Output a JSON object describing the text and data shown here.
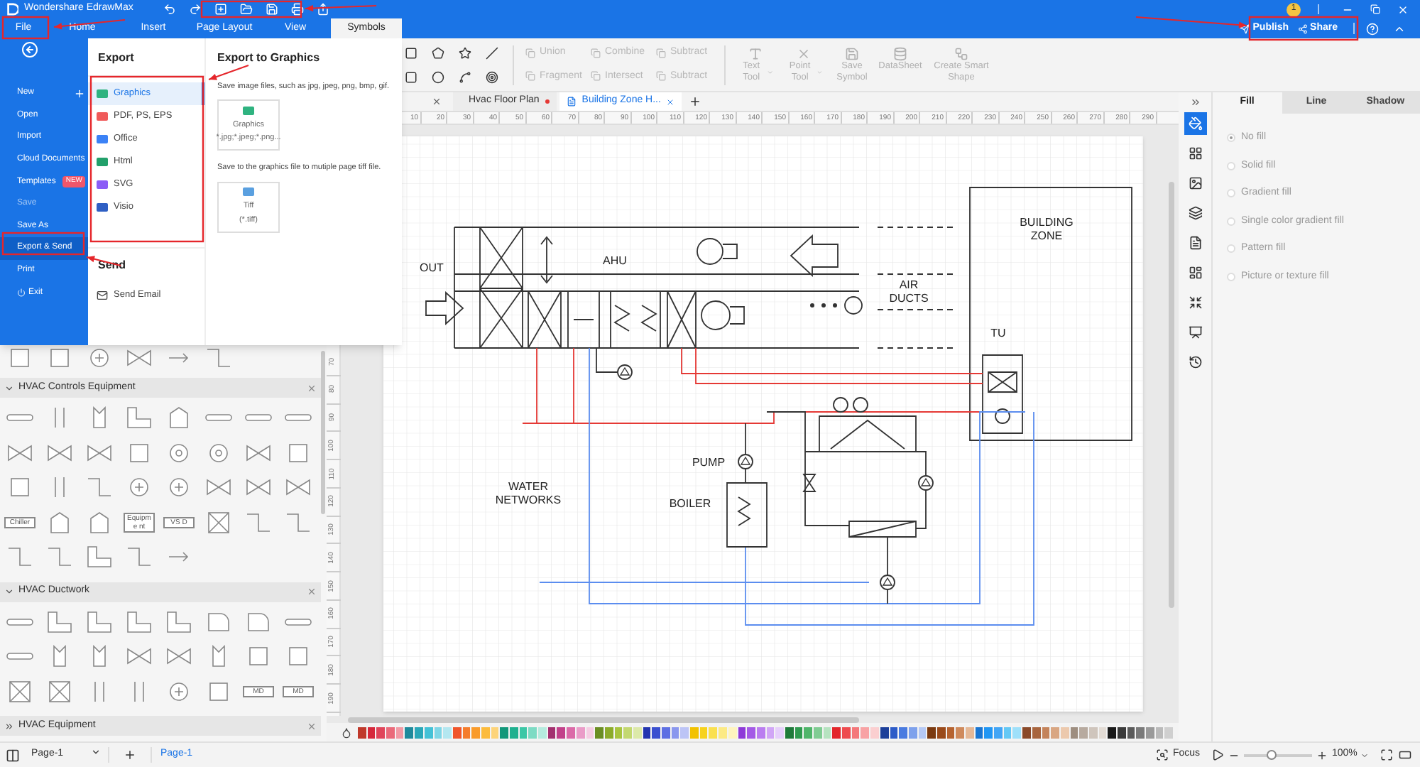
{
  "title_bar": {
    "app_title": "Wondershare EdrawMax",
    "notification_count": "1"
  },
  "menu_tabs": [
    {
      "label": "File",
      "selected": false
    },
    {
      "label": "Home",
      "selected": false
    },
    {
      "label": "Insert",
      "selected": false
    },
    {
      "label": "Page Layout",
      "selected": false
    },
    {
      "label": "View",
      "selected": false
    },
    {
      "label": "Symbols",
      "selected": true
    }
  ],
  "header_actions": [
    {
      "label": "Publish",
      "kind": "publish"
    },
    {
      "label": "Share",
      "kind": "share"
    }
  ],
  "file_menu": {
    "items": [
      {
        "label": "New",
        "kind": "new",
        "selected": false,
        "disabled": false
      },
      {
        "label": "Open",
        "kind": "plain",
        "selected": false,
        "disabled": false
      },
      {
        "label": "Import",
        "kind": "plain",
        "selected": false,
        "disabled": false
      },
      {
        "label": "Cloud Documents",
        "kind": "plain",
        "selected": false,
        "disabled": false
      },
      {
        "label": "Templates",
        "kind": "plain",
        "badge": "NEW",
        "selected": false,
        "disabled": false
      },
      {
        "label": "Save",
        "kind": "plain",
        "selected": false,
        "disabled": true
      },
      {
        "label": "Save As",
        "kind": "plain",
        "selected": false,
        "disabled": false
      },
      {
        "label": "Export & Send",
        "kind": "plain",
        "selected": true,
        "disabled": false
      },
      {
        "label": "Print",
        "kind": "plain",
        "selected": false,
        "disabled": false
      },
      {
        "label": "Exit",
        "kind": "exit",
        "selected": false,
        "disabled": false
      }
    ]
  },
  "export_panel": {
    "title": "Export",
    "formats": [
      {
        "label": "Graphics",
        "selected": true,
        "color": "#2fb380"
      },
      {
        "label": "PDF, PS, EPS",
        "selected": false,
        "color": "#f05a5a"
      },
      {
        "label": "Office",
        "selected": false,
        "color": "#3b82f6"
      },
      {
        "label": "Html",
        "selected": false,
        "color": "#22a06b"
      },
      {
        "label": "SVG",
        "selected": false,
        "color": "#8b5cf6"
      },
      {
        "label": "Visio",
        "selected": false,
        "color": "#2f5fc4"
      }
    ],
    "send_title": "Send",
    "send_items": [
      {
        "label": "Send Email"
      }
    ]
  },
  "export_detail": {
    "title": "Export to Graphics",
    "sections": [
      {
        "description": "Save image files, such as jpg, jpeg, png, bmp, gif.",
        "card_label": "Graphics",
        "card_sublabel": "*.jpg;*.jpeg;*.png...",
        "color": "#2fb380"
      },
      {
        "description": "Save to the graphics file to mutiple page tiff file.",
        "card_label": "Tiff",
        "card_sublabel": "(*.tiff)",
        "color": "#5aa0e0"
      }
    ]
  },
  "toolbar": {
    "boolean_ops": [
      {
        "label": "Union",
        "disabled": true
      },
      {
        "label": "Combine",
        "disabled": true
      },
      {
        "label": "Subtract",
        "disabled": true
      },
      {
        "label": "Fragment",
        "disabled": true
      },
      {
        "label": "Intersect",
        "disabled": true
      },
      {
        "label": "Subtract",
        "disabled": true
      }
    ],
    "tools": [
      {
        "label": "Text Tool",
        "kind": "text",
        "dropdown": true,
        "disabled": true
      },
      {
        "label": "Point Tool",
        "kind": "point",
        "dropdown": true,
        "disabled": true
      },
      {
        "label": "Save Symbol",
        "kind": "save",
        "dropdown": false,
        "disabled": true
      },
      {
        "label": "DataSheet",
        "kind": "data",
        "dropdown": false,
        "disabled": true
      },
      {
        "label": "Create Smart Shape",
        "kind": "smart",
        "dropdown": false,
        "disabled": true
      }
    ]
  },
  "document_tabs": [
    {
      "label": "Hvac Floor Plan",
      "selected": false,
      "unsaved": true
    },
    {
      "label": "Building Zone H...",
      "selected": true,
      "unsaved": false
    }
  ],
  "rulers": {
    "horizontal": [
      "10",
      "20",
      "30",
      "40",
      "50",
      "60",
      "70",
      "80",
      "90",
      "100",
      "110",
      "120",
      "130",
      "140",
      "150",
      "160",
      "170",
      "180",
      "190",
      "200",
      "210",
      "220",
      "230",
      "240",
      "250",
      "260",
      "270",
      "280",
      "290"
    ],
    "vertical": [
      "70",
      "80",
      "90",
      "100",
      "110",
      "120",
      "130",
      "140",
      "150",
      "160",
      "170",
      "180",
      "190"
    ]
  },
  "diagram": {
    "labels": [
      {
        "kind": "out",
        "lines": [
          "OUT"
        ]
      },
      {
        "kind": "ahu",
        "lines": [
          "AHU"
        ]
      },
      {
        "kind": "air_ducts",
        "lines": [
          "AIR",
          "DUCTS"
        ]
      },
      {
        "kind": "building_zone",
        "lines": [
          "BUILDING",
          "ZONE"
        ]
      },
      {
        "kind": "tu",
        "lines": [
          "TU"
        ]
      },
      {
        "kind": "pump",
        "lines": [
          "PUMP"
        ]
      },
      {
        "kind": "water_networks",
        "lines": [
          "WATER",
          "NETWORKS"
        ]
      },
      {
        "kind": "boiler",
        "lines": [
          "BOILER"
        ]
      }
    ]
  },
  "library": {
    "top_row": [
      {
        "kind": "box"
      },
      {
        "kind": "box"
      },
      {
        "kind": "circle"
      },
      {
        "kind": "valve"
      },
      {
        "kind": "arrow"
      },
      {
        "kind": "step"
      }
    ],
    "sections": [
      {
        "title": "HVAC Controls Equipment",
        "expanded": true,
        "shapes": [
          {
            "kind": "bar"
          },
          {
            "kind": "lines"
          },
          {
            "kind": "tee"
          },
          {
            "kind": "elbow"
          },
          {
            "kind": "tank"
          },
          {
            "kind": "bar"
          },
          {
            "kind": "bar"
          },
          {
            "kind": "bar"
          },
          {
            "kind": "valve"
          },
          {
            "kind": "valve"
          },
          {
            "kind": "valve"
          },
          {
            "kind": "box"
          },
          {
            "kind": "fan"
          },
          {
            "kind": "fan"
          },
          {
            "kind": "valve"
          },
          {
            "kind": "box"
          },
          {
            "kind": "box"
          },
          {
            "kind": "lines"
          },
          {
            "kind": "step"
          },
          {
            "kind": "circle"
          },
          {
            "kind": "circle"
          },
          {
            "kind": "valve"
          },
          {
            "kind": "valve"
          },
          {
            "kind": "valve"
          },
          {
            "kind": "label",
            "label": "Chiller"
          },
          {
            "kind": "tank"
          },
          {
            "kind": "tank"
          },
          {
            "kind": "label",
            "label": "Equipme nt"
          },
          {
            "kind": "label",
            "label": "VS D"
          },
          {
            "kind": "box-x"
          },
          {
            "kind": "step"
          },
          {
            "kind": "step"
          },
          {
            "kind": "step"
          },
          {
            "kind": "step"
          },
          {
            "kind": "elbow"
          },
          {
            "kind": "step"
          },
          {
            "kind": "arrow"
          }
        ]
      },
      {
        "title": "HVAC Ductwork",
        "expanded": true,
        "shapes": [
          {
            "kind": "bar"
          },
          {
            "kind": "elbow"
          },
          {
            "kind": "elbow"
          },
          {
            "kind": "elbow"
          },
          {
            "kind": "elbow"
          },
          {
            "kind": "curve"
          },
          {
            "kind": "curve"
          },
          {
            "kind": "bar"
          },
          {
            "kind": "bar"
          },
          {
            "kind": "tee"
          },
          {
            "kind": "tee"
          },
          {
            "kind": "valve"
          },
          {
            "kind": "valve"
          },
          {
            "kind": "tee"
          },
          {
            "kind": "box"
          },
          {
            "kind": "box"
          },
          {
            "kind": "box-x"
          },
          {
            "kind": "box-x"
          },
          {
            "kind": "lines"
          },
          {
            "kind": "lines"
          },
          {
            "kind": "circle"
          },
          {
            "kind": "box"
          },
          {
            "kind": "label",
            "label": "MD"
          },
          {
            "kind": "label",
            "label": "MD"
          }
        ]
      },
      {
        "title": "HVAC Equipment",
        "expanded": false
      }
    ]
  },
  "color_palette": [
    {
      "color": "#c0392b"
    },
    {
      "color": "#d6283b"
    },
    {
      "color": "#e0455a"
    },
    {
      "color": "#ea6a7a"
    },
    {
      "color": "#f29aa5"
    },
    {
      "color": "#1f8a9c"
    },
    {
      "color": "#2aa7b8"
    },
    {
      "color": "#44c1d6"
    },
    {
      "color": "#7fd6e6"
    },
    {
      "color": "#b3e7f0"
    },
    {
      "color": "#f0552b"
    },
    {
      "color": "#f57c2c"
    },
    {
      "color": "#f99b2a"
    },
    {
      "color": "#fcbb3c"
    },
    {
      "color": "#fdd47a"
    },
    {
      "color": "#12977a"
    },
    {
      "color": "#1fb08f"
    },
    {
      "color": "#3cc7a6"
    },
    {
      "color": "#7ddbc4"
    },
    {
      "color": "#b5ebde"
    },
    {
      "color": "#a3306f"
    },
    {
      "color": "#c2418a"
    },
    {
      "color": "#db6aa8"
    },
    {
      "color": "#ea9cc8"
    },
    {
      "color": "#f5cde3"
    },
    {
      "color": "#6b8e23"
    },
    {
      "color": "#8cab2a"
    },
    {
      "color": "#a8c43f"
    },
    {
      "color": "#c3d870"
    },
    {
      "color": "#dce9a9"
    },
    {
      "color": "#2335b0"
    },
    {
      "color": "#3a4fd0"
    },
    {
      "color": "#5d6fe3"
    },
    {
      "color": "#8a97ee"
    },
    {
      "color": "#bcc4f6"
    },
    {
      "color": "#f2c200"
    },
    {
      "color": "#f7d21c"
    },
    {
      "color": "#fae04f"
    },
    {
      "color": "#fcea85"
    },
    {
      "color": "#fef4bf"
    },
    {
      "color": "#8e3ad8"
    },
    {
      "color": "#a45ae6"
    },
    {
      "color": "#ba7df0"
    },
    {
      "color": "#d1a6f6"
    },
    {
      "color": "#e6cffb"
    },
    {
      "color": "#1f7a3a"
    },
    {
      "color": "#2e9a4e"
    },
    {
      "color": "#4fb56a"
    },
    {
      "color": "#80cc93"
    },
    {
      "color": "#b6e3c0"
    },
    {
      "color": "#e3262b"
    },
    {
      "color": "#ee4b4f"
    },
    {
      "color": "#f4777a"
    },
    {
      "color": "#f8a2a4"
    },
    {
      "color": "#fbcfd0"
    },
    {
      "color": "#1c3f9a"
    },
    {
      "color": "#2c5bc8"
    },
    {
      "color": "#4a7be0"
    },
    {
      "color": "#7ea1ec"
    },
    {
      "color": "#b5c9f5"
    },
    {
      "color": "#7b3a10"
    },
    {
      "color": "#9a4a1a"
    },
    {
      "color": "#b66330"
    },
    {
      "color": "#cf8a5c"
    },
    {
      "color": "#e5b896"
    },
    {
      "color": "#1976d2"
    },
    {
      "color": "#2196f3"
    },
    {
      "color": "#42a5f5"
    },
    {
      "color": "#64c8f5"
    },
    {
      "color": "#9ee0fa"
    },
    {
      "color": "#8a4a2a"
    },
    {
      "color": "#a8653e"
    },
    {
      "color": "#c4835a"
    },
    {
      "color": "#d9a682"
    },
    {
      "color": "#ecc9ad"
    },
    {
      "color": "#9e8e80"
    },
    {
      "color": "#b7aa9f"
    },
    {
      "color": "#cfc5bc"
    },
    {
      "color": "#e3dcd5"
    },
    {
      "color": "#1a1a1a"
    },
    {
      "color": "#3a3a3a"
    },
    {
      "color": "#5a5a5a"
    },
    {
      "color": "#7a7a7a"
    },
    {
      "color": "#9a9a9a"
    },
    {
      "color": "#bababa"
    },
    {
      "color": "#cfcfcf"
    }
  ],
  "right_panel": {
    "tabs": [
      {
        "label": "Fill",
        "selected": true
      },
      {
        "label": "Line",
        "selected": false
      },
      {
        "label": "Shadow",
        "selected": false
      }
    ],
    "side_icons": [
      {
        "kind": "fill",
        "selected": true
      },
      {
        "kind": "grid",
        "selected": false
      },
      {
        "kind": "image",
        "selected": false
      },
      {
        "kind": "layers",
        "selected": false
      },
      {
        "kind": "page",
        "selected": false
      },
      {
        "kind": "dashboard",
        "selected": false
      },
      {
        "kind": "shrink",
        "selected": false
      },
      {
        "kind": "present",
        "selected": false
      },
      {
        "kind": "history",
        "selected": false
      }
    ],
    "fill_options": [
      {
        "label": "No fill",
        "selected": true
      },
      {
        "label": "Solid fill",
        "selected": false
      },
      {
        "label": "Gradient fill",
        "selected": false
      },
      {
        "label": "Single color gradient fill",
        "selected": false
      },
      {
        "label": "Pattern fill",
        "selected": false
      },
      {
        "label": "Picture or texture fill",
        "selected": false
      }
    ]
  },
  "status_bar": {
    "page_select": "Page-1",
    "pages": [
      {
        "label": "Page-1",
        "selected": true
      }
    ],
    "focus": "Focus",
    "zoom": {
      "level": 0.4
    },
    "zoom_value": "100%"
  }
}
